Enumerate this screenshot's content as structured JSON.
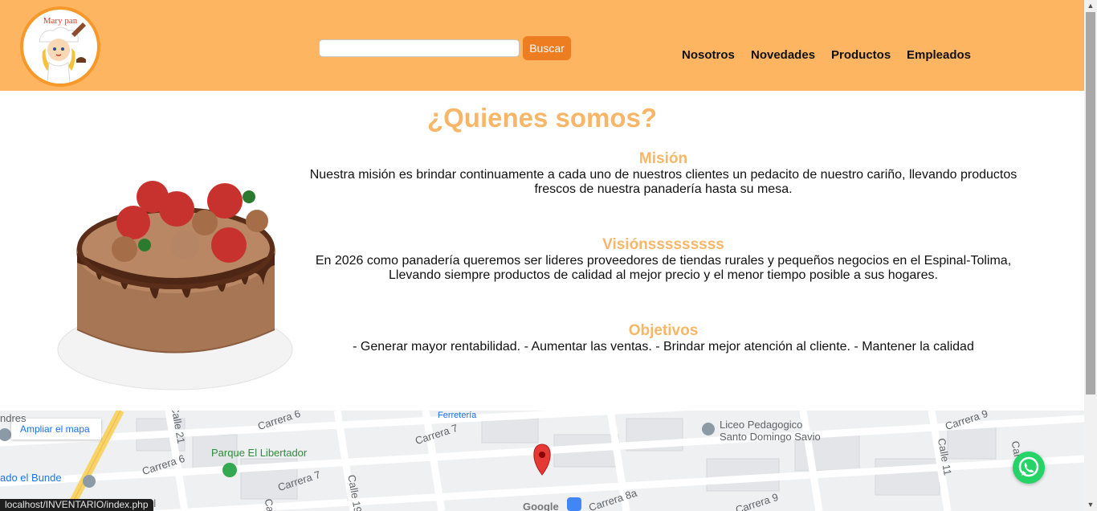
{
  "header": {
    "logo_text": "Mary pan",
    "search": {
      "placeholder": "",
      "value": "",
      "button_label": "Buscar"
    },
    "nav": [
      "Nosotros",
      "Novedades",
      "Productos",
      "Empleados"
    ]
  },
  "main": {
    "title": "¿Quienes somos?",
    "sections": [
      {
        "heading": "Misión",
        "text": "Nuestra misión es brindar continuamente a cada uno de nuestros clientes un pedacito de nuestro cariño, llevando productos frescos de nuestra panadería hasta su mesa."
      },
      {
        "heading": "Visiónsssssssss",
        "text": "En 2026 como panadería queremos ser lideres proveedores de tiendas rurales y pequeños negocios en el Espinal-Tolima, Llevando siempre productos de calidad al mejor precio y el menor tiempo posible a sus hogares."
      },
      {
        "heading": "Objetivos",
        "text": "- Generar mayor rentabilidad. - Aumentar las ventas. - Brindar mejor atención al cliente. - Mantener la calidad"
      }
    ]
  },
  "map": {
    "enlarge_label": "Ampliar el mapa",
    "labels": {
      "andres": "ndres",
      "carrera6_top": "Carrera 6",
      "calle21": "Calle 21",
      "ferreteria": "Ferretería",
      "carrera7_top": "Carrera 7",
      "liceo1": "Liceo Pedagogico",
      "liceo2": "Santo Domingo Savio",
      "carrera9_top": "Carrera 9",
      "parque": "Parque El Libertador",
      "carrera6_mid": "Carrera 6",
      "carrera7_mid": "Carrera 7",
      "calle11": "Calle 11",
      "bunde": "ado el Bunde",
      "calle19": "Calle 19",
      "carrera8a": "Carrera 8a",
      "carrera9_bottom": "Carrera 9",
      "google": "Google",
      "cal_left": "Cal",
      "cal_right": "Cal",
      "al": "al"
    }
  },
  "status_bar": "localhost/INVENTARIO/index.php",
  "colors": {
    "header_bg": "#feb562",
    "accent": "#f7b668",
    "button": "#ee7d22",
    "whatsapp": "#25d366"
  }
}
